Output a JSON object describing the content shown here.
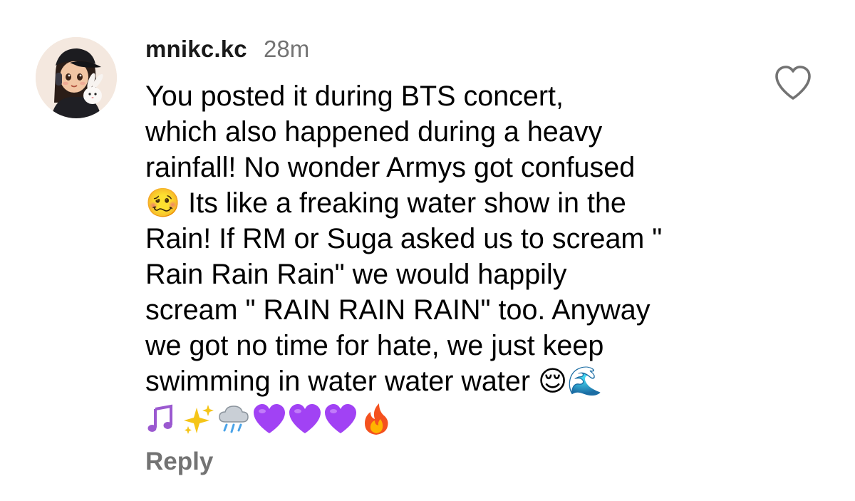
{
  "comment": {
    "username": "mnikc.kc",
    "timestamp": "28m",
    "text": "You posted it during BTS concert,\nwhich also happened during a heavy\nrainfall! No wonder Armys got confused\n🥴 Its like a freaking water show in the\nRain! If RM or Suga asked us to scream \"\nRain Rain Rain\" we would happily\nscream \" RAIN RAIN RAIN\" too.  Anyway\nwe got no time for hate, we just keep\nswimming in water water water 😌🌊",
    "trailing_emojis": [
      "🎶",
      "✨",
      "🌧️",
      "💜",
      "💜",
      "💜",
      "🔥"
    ],
    "reply_label": "Reply"
  },
  "icons": {
    "avatar": "avatar-cartoon-girl-with-bunny",
    "like": "heart-outline-icon"
  },
  "colors": {
    "text": "#000000",
    "secondary_text": "#737373",
    "background": "#ffffff",
    "heart_stroke": "#737373"
  }
}
